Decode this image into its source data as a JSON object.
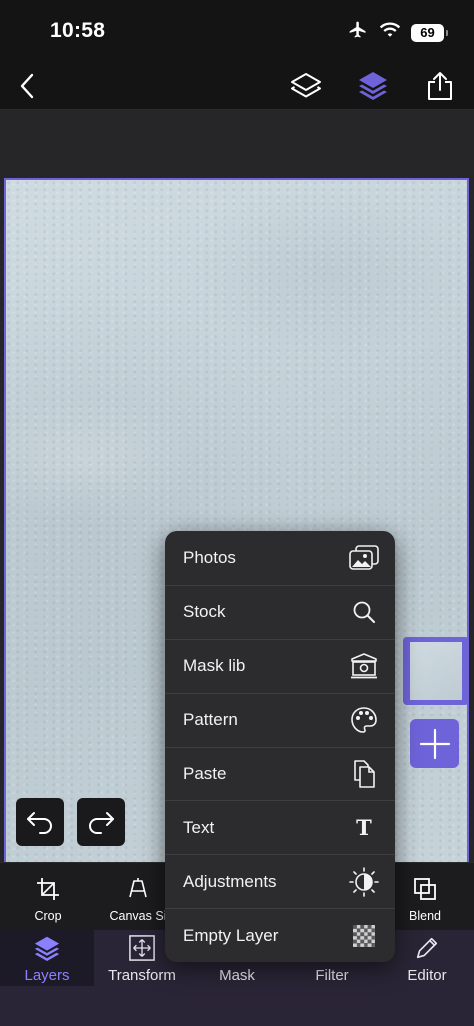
{
  "status_bar": {
    "time": "10:58",
    "battery": "69",
    "icons": [
      "airplane-icon",
      "wifi-icon",
      "battery-icon"
    ]
  },
  "nav": {
    "icons": [
      "back-icon",
      "layers-outline-icon",
      "layers-filled-icon",
      "share-icon"
    ]
  },
  "colors": {
    "accent": "#6f63d9",
    "accent_text": "#8b80ff",
    "menu_bg": "#2c2c2e",
    "tab_bg": "#2a2536"
  },
  "add_menu": {
    "items": [
      {
        "label": "Photos",
        "icon": "photos-icon"
      },
      {
        "label": "Stock",
        "icon": "search-icon"
      },
      {
        "label": "Mask lib",
        "icon": "museum-icon"
      },
      {
        "label": "Pattern",
        "icon": "palette-icon"
      },
      {
        "label": "Paste",
        "icon": "paste-icon"
      },
      {
        "label": "Text",
        "icon": "text-icon"
      },
      {
        "label": "Adjustments",
        "icon": "adjustments-icon"
      },
      {
        "label": "Empty Layer",
        "icon": "checkerboard-icon"
      }
    ]
  },
  "tools": {
    "items": [
      {
        "label": "Crop",
        "icon": "crop-icon"
      },
      {
        "label": "Canvas Si",
        "icon": "canvas-size-icon"
      },
      {
        "label": "Blend",
        "icon": "blend-icon"
      }
    ]
  },
  "tabs": {
    "items": [
      {
        "label": "Layers",
        "icon": "layers-icon",
        "active": true
      },
      {
        "label": "Transform",
        "icon": "transform-icon",
        "active": false
      },
      {
        "label": "Mask",
        "icon": "mask-icon",
        "active": false
      },
      {
        "label": "Filter",
        "icon": "filter-icon",
        "active": false
      },
      {
        "label": "Editor",
        "icon": "pencil-icon",
        "active": false
      }
    ]
  }
}
